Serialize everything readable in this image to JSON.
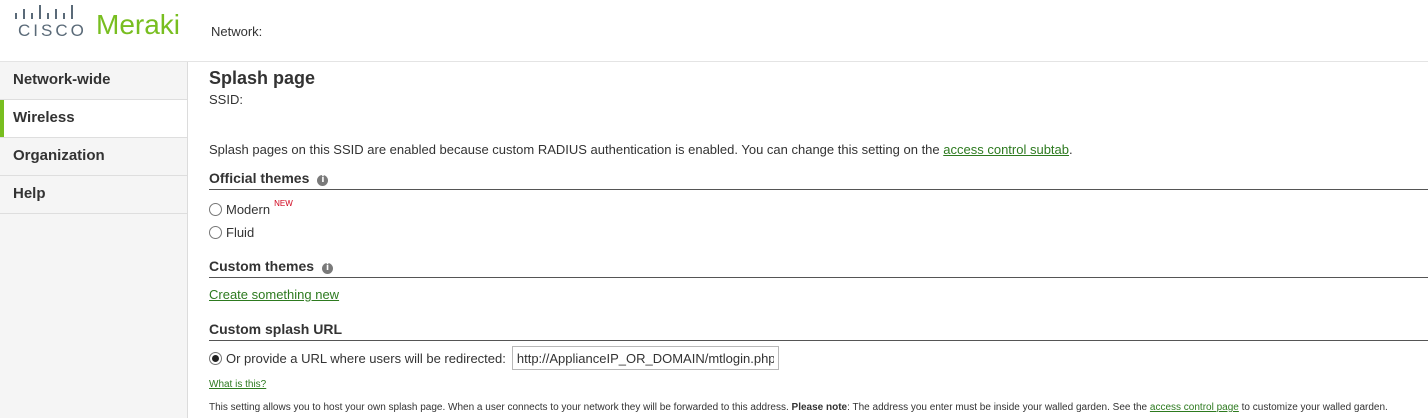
{
  "header": {
    "brand_cisco": "CISCO",
    "brand_meraki": "Meraki",
    "network_label": "Network:"
  },
  "sidebar": {
    "items": [
      {
        "label": "Network-wide",
        "active": false
      },
      {
        "label": "Wireless",
        "active": true
      },
      {
        "label": "Organization",
        "active": false
      },
      {
        "label": "Help",
        "active": false
      }
    ]
  },
  "main": {
    "title": "Splash page",
    "ssid_label": "SSID:",
    "info_text_prefix": "Splash pages on this SSID are enabled because custom RADIUS authentication is enabled. You can change this setting on the ",
    "info_link": "access control subtab",
    "info_text_suffix": ".",
    "official_themes": {
      "title": "Official themes",
      "options": [
        {
          "label": "Modern",
          "badge": "NEW",
          "checked": false
        },
        {
          "label": "Fluid",
          "checked": false
        }
      ]
    },
    "custom_themes": {
      "title": "Custom themes",
      "create_link": "Create something new"
    },
    "custom_splash": {
      "title": "Custom splash URL",
      "option_label": "Or provide a URL where users will be redirected:",
      "checked": true,
      "url_value": "http://ApplianceIP_OR_DOMAIN/mtlogin.php",
      "what_link": "What is this?",
      "note_text_1": "This setting allows you to host your own splash page. When a user connects to your network they will be forwarded to this address. ",
      "note_bold": "Please note",
      "note_text_2": ": The address you enter must be inside your walled garden. See the ",
      "note_link": "access control page",
      "note_text_3": " to customize your walled garden."
    }
  },
  "colors": {
    "brand_green": "#78be20",
    "link_green": "#2d7a1f",
    "badge_red": "#d0021b"
  }
}
